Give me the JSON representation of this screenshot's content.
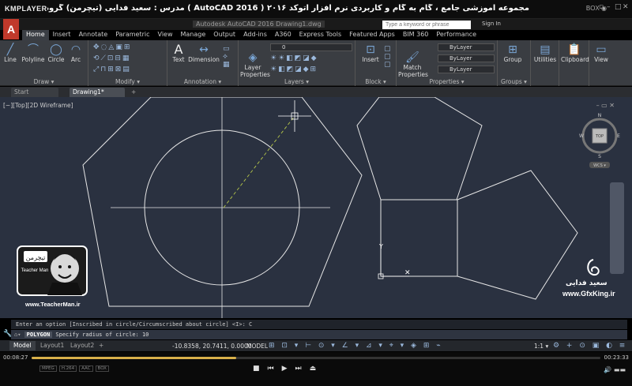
{
  "player": {
    "logo": "KMPLAYER",
    "title": "مجموعه آموزشی جامع ، گام به گام و کاربردی نرم افزار  اتوکد ۲۰۱۶ ( AutoCAD 2016 )  مدرس : سعید فدایی (تیچرمن) گروه آموزشی پادشاه گرافیست ها",
    "menu_label": "BOX ◉",
    "time_elapsed": "00:08:27",
    "time_total": "00:23:33",
    "progress": 0.36,
    "codec_tags": [
      "MPEG",
      "H.264",
      "AAC",
      "BOX"
    ]
  },
  "acad": {
    "logo": "A",
    "window_title": "Autodesk AutoCAD 2016    Drawing1.dwg",
    "search_placeholder": "Type a keyword or phrase",
    "signin": "Sign In"
  },
  "ribbon_tabs": [
    "Home",
    "Insert",
    "Annotate",
    "Parametric",
    "View",
    "Manage",
    "Output",
    "Add-ins",
    "A360",
    "Express Tools",
    "Featured Apps",
    "BIM 360",
    "Performance"
  ],
  "ribbon": {
    "draw_tools": [
      "Line",
      "Polyline",
      "Circle",
      "Arc"
    ],
    "draw_title": "Draw ▾",
    "modify_title": "Modify ▾",
    "annotation_tools": [
      "Text",
      "Dimension"
    ],
    "annotation_title": "Annotation ▾",
    "layer_props": "Layer Properties",
    "layer_combo": "0",
    "layers_title": "Layers ▾",
    "insert": "Insert",
    "block_title": "Block ▾",
    "match_props": "Match Properties",
    "bylayer": "ByLayer",
    "properties_title": "Properties ▾",
    "group": "Group",
    "groups_title": "Groups ▾",
    "utilities": "Utilities",
    "clipboard": "Clipboard",
    "view": "View"
  },
  "doc_tabs": [
    "Start",
    "Drawing1*",
    "+"
  ],
  "viewport_label": "[−][Top][2D Wireframe]",
  "viewcube": {
    "top": "TOP",
    "n": "N",
    "s": "S",
    "e": "E",
    "w": "W",
    "wcs": "WCS ▾"
  },
  "command": {
    "history": "Enter an option [Inscribed in circle/Circumscribed about circle] <I>: C",
    "cmd_name": "POLYGON",
    "prompt": "Specify radius of circle: 10"
  },
  "status": {
    "layout_tabs": [
      "Model",
      "Layout1",
      "Layout2",
      "+"
    ],
    "coords": "-10.8358, 20.7411, 0.0000",
    "model": "MODEL",
    "scale": "1:1 ▾"
  },
  "watermark": {
    "left_site": "www.TeacherMan.ir",
    "left_badge": "تیچرمن",
    "left_sub": "Teacher Man",
    "right_name": "سعید فدایی",
    "right_site": "www.GfxKing.ir"
  },
  "colors": {
    "canvas_bg": "#2a3140",
    "ribbon_bg": "#3a3d42",
    "line": "#e6e6e6",
    "dash": "#b8c94a",
    "accent": "#c0392b"
  }
}
